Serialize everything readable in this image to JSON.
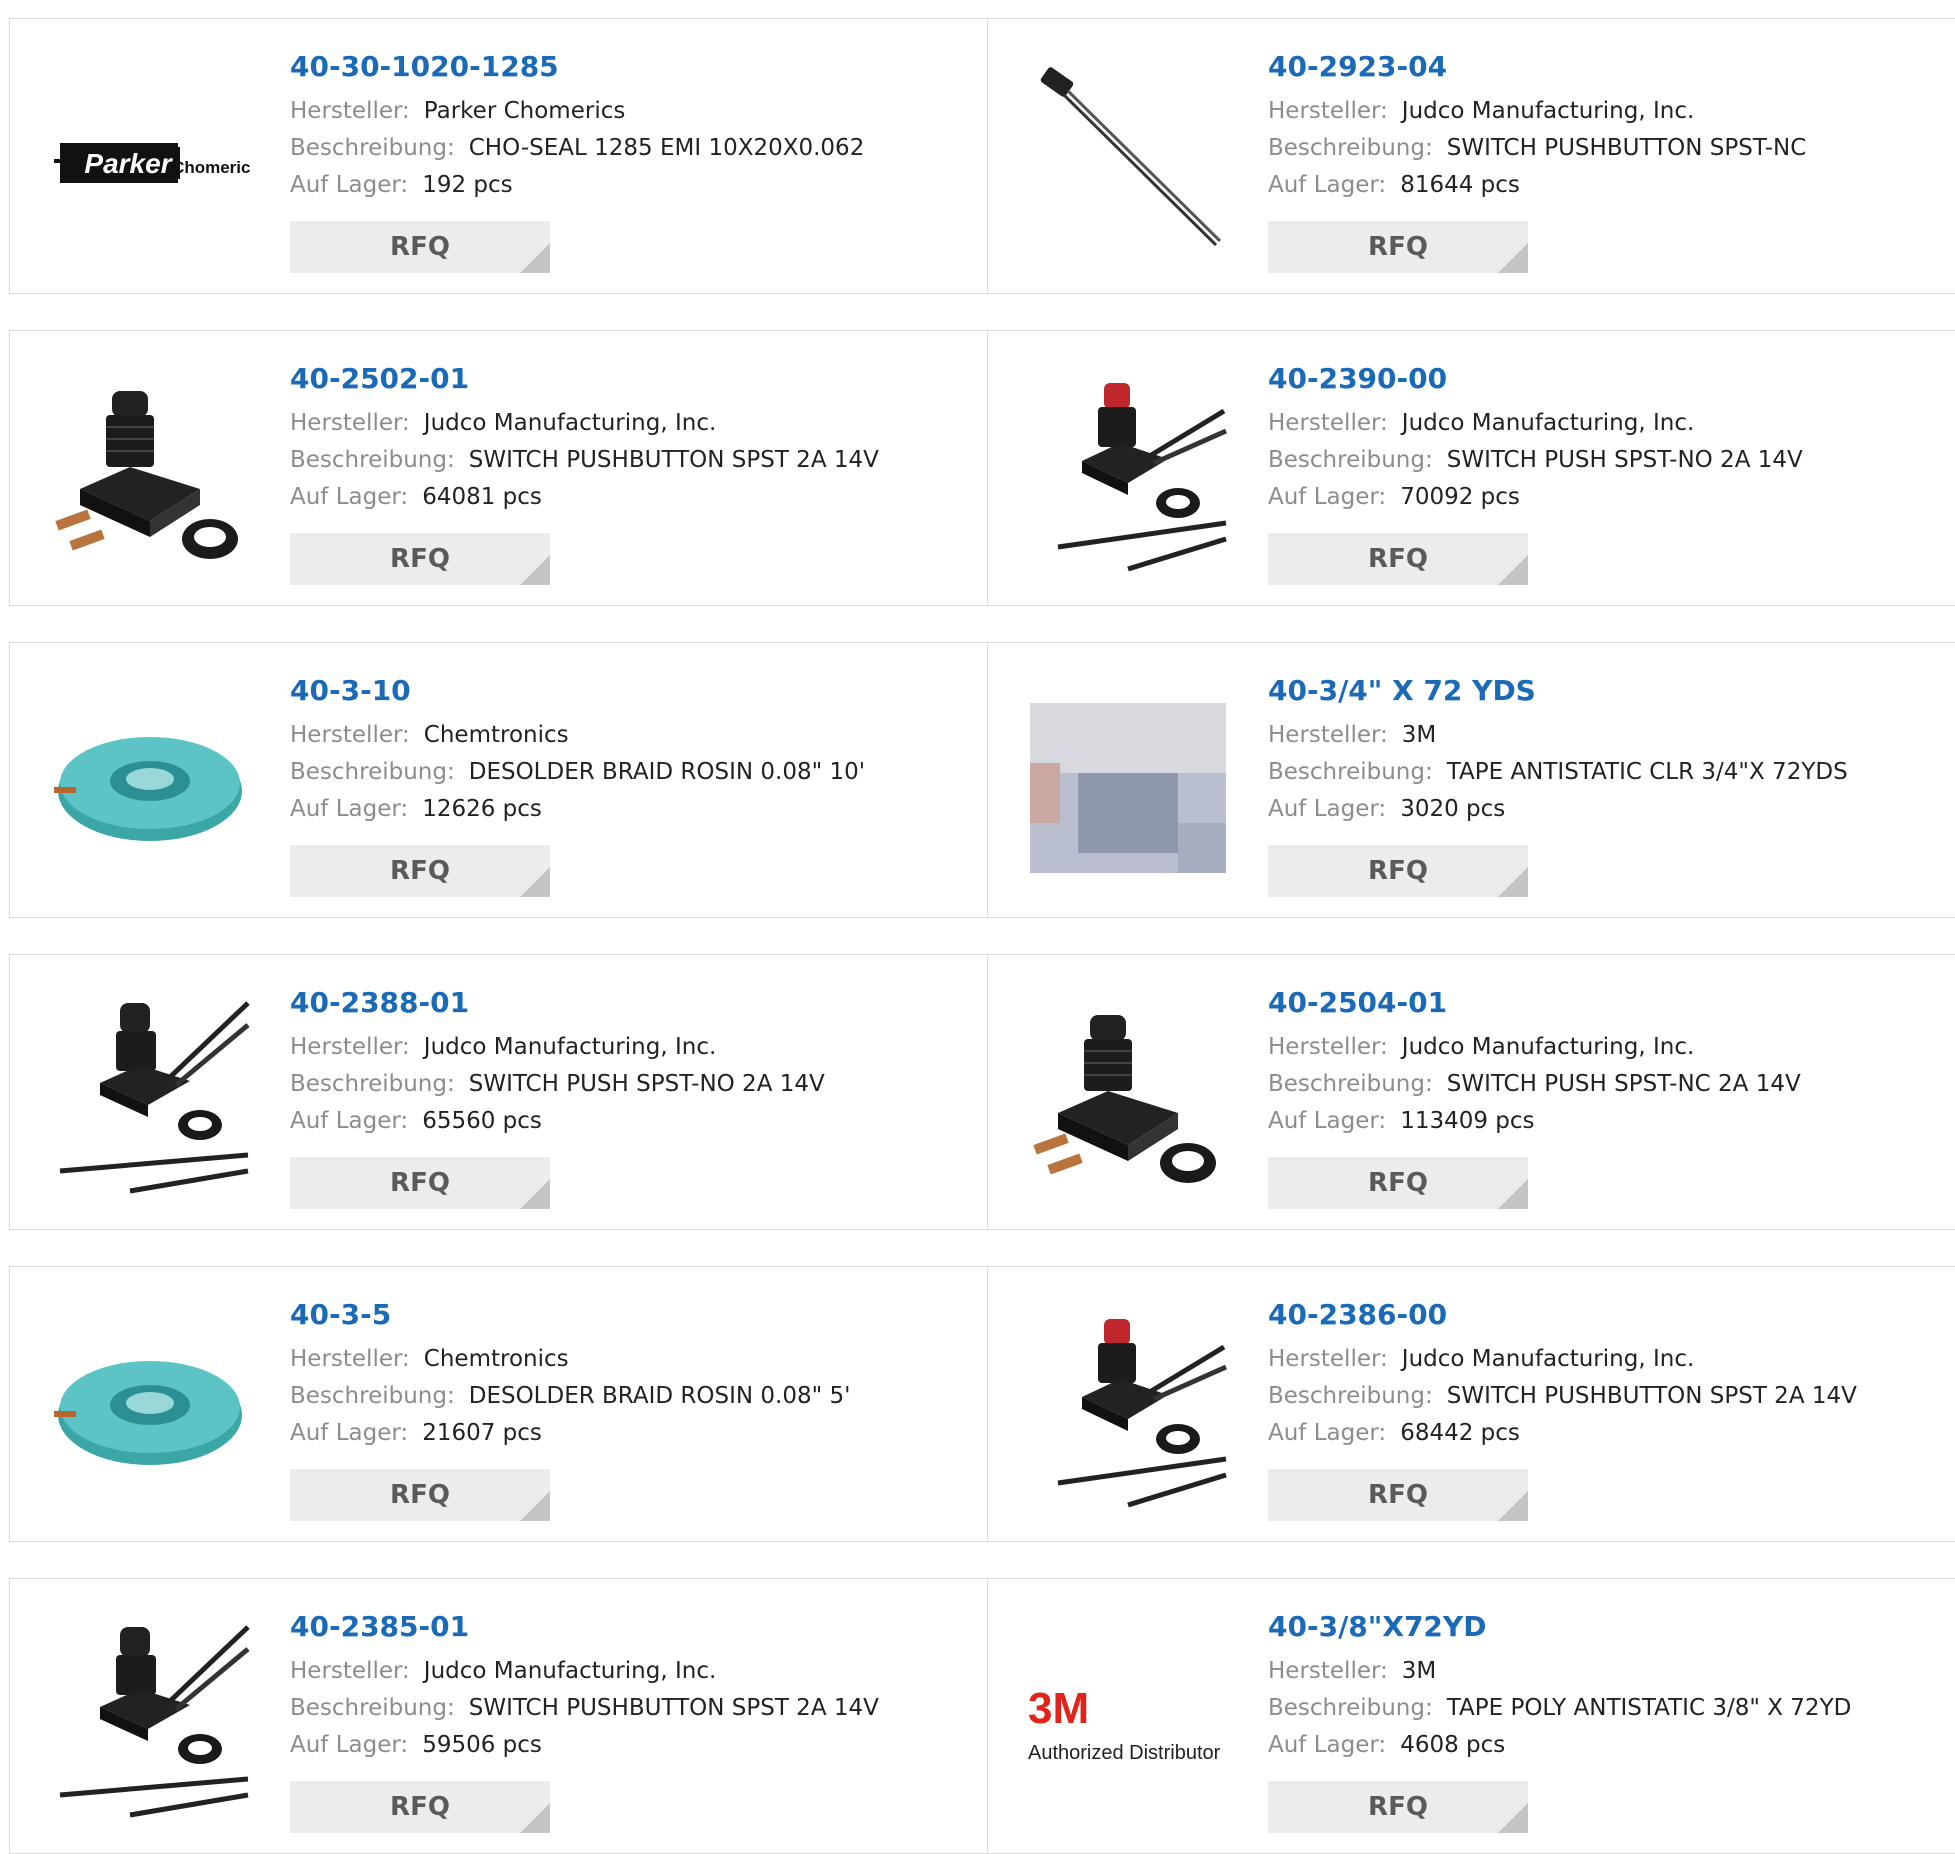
{
  "labels": {
    "manufacturer": "Hersteller:",
    "description": "Beschreibung:",
    "stock": "Auf Lager:",
    "rfq": "RFQ"
  },
  "colors": {
    "part_link": "#1b6ab7",
    "label_gray": "#8c8c8c",
    "button_bg": "#ececec",
    "border": "#dcdcdc"
  },
  "logos": {
    "parker_word": "Parker",
    "parker_sub": "Chomerics",
    "threem_word": "3M",
    "threem_sub": "Authorized Distributor"
  },
  "products": [
    {
      "part": "40-30-1020-1285",
      "manufacturer": "Parker Chomerics",
      "description": "CHO-SEAL 1285 EMI 10X20X0.062",
      "stock": "192 pcs",
      "image": "parker-chomerics-logo"
    },
    {
      "part": "40-2923-04",
      "manufacturer": "Judco Manufacturing, Inc.",
      "description": "SWITCH PUSHBUTTON SPST-NC",
      "stock": "81644 pcs",
      "image": "wire-lead-switch-image"
    },
    {
      "part": "40-2502-01",
      "manufacturer": "Judco Manufacturing, Inc.",
      "description": "SWITCH PUSHBUTTON SPST 2A 14V",
      "stock": "64081 pcs",
      "image": "pushbutton-tabs-image"
    },
    {
      "part": "40-2390-00",
      "manufacturer": "Judco Manufacturing, Inc.",
      "description": "SWITCH PUSH SPST-NO 2A 14V",
      "stock": "70092 pcs",
      "image": "pushbutton-red-wires-image"
    },
    {
      "part": "40-3-10",
      "manufacturer": "Chemtronics",
      "description": "DESOLDER BRAID ROSIN 0.08\" 10'",
      "stock": "12626 pcs",
      "image": "desolder-braid-image"
    },
    {
      "part": "40-3/4\" X 72 YDS",
      "manufacturer": "3M",
      "description": "TAPE ANTISTATIC CLR 3/4\"X 72YDS",
      "stock": "3020 pcs",
      "image": "antistatic-tape-image"
    },
    {
      "part": "40-2388-01",
      "manufacturer": "Judco Manufacturing, Inc.",
      "description": "SWITCH PUSH SPST-NO 2A 14V",
      "stock": "65560 pcs",
      "image": "pushbutton-black-wires-image"
    },
    {
      "part": "40-2504-01",
      "manufacturer": "Judco Manufacturing, Inc.",
      "description": "SWITCH PUSH SPST-NC 2A 14V",
      "stock": "113409 pcs",
      "image": "pushbutton-tabs-image"
    },
    {
      "part": "40-3-5",
      "manufacturer": "Chemtronics",
      "description": "DESOLDER BRAID ROSIN 0.08\" 5'",
      "stock": "21607 pcs",
      "image": "desolder-braid-image"
    },
    {
      "part": "40-2386-00",
      "manufacturer": "Judco Manufacturing, Inc.",
      "description": "SWITCH PUSHBUTTON SPST 2A 14V",
      "stock": "68442 pcs",
      "image": "pushbutton-red-wires-image"
    },
    {
      "part": "40-2385-01",
      "manufacturer": "Judco Manufacturing, Inc.",
      "description": "SWITCH PUSHBUTTON SPST 2A 14V",
      "stock": "59506 pcs",
      "image": "pushbutton-black-wires-image"
    },
    {
      "part": "40-3/8\"X72YD",
      "manufacturer": "3M",
      "description": "TAPE POLY ANTISTATIC 3/8\" X 72YD",
      "stock": "4608 pcs",
      "image": "3m-authorized-distributor-logo"
    }
  ]
}
